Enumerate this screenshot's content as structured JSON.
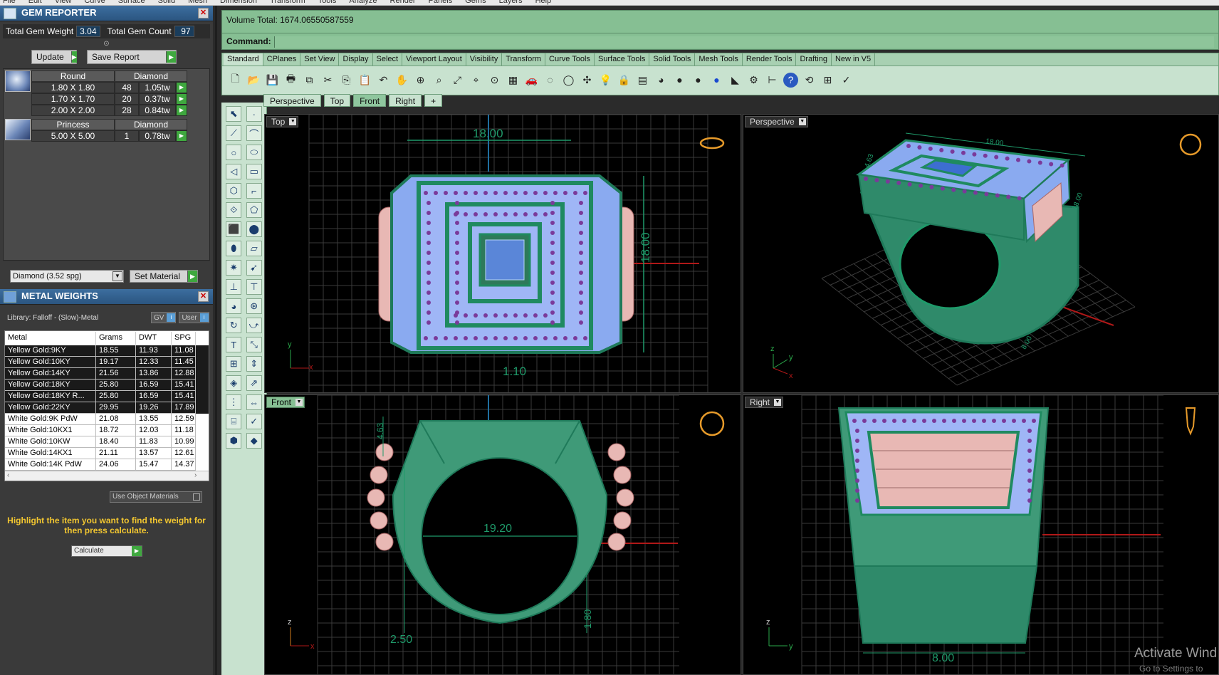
{
  "menubar": [
    "File",
    "Edit",
    "View",
    "Curve",
    "Surface",
    "Solid",
    "Mesh",
    "Dimension",
    "Transform",
    "Tools",
    "Analyze",
    "Render",
    "Panels",
    "Gems",
    "Layers",
    "Help"
  ],
  "gem_reporter": {
    "title": "GEM REPORTER",
    "total_weight_label": "Total Gem Weight",
    "total_weight": "3.04",
    "total_count_label": "Total Gem Count",
    "total_count": "97",
    "update_label": "Update",
    "save_report_label": "Save Report",
    "groups": [
      {
        "shape": "Round",
        "material": "Diamond",
        "rows": [
          {
            "size": "1.80 X 1.80",
            "count": "48",
            "tw": "1.05tw"
          },
          {
            "size": "1.70 X 1.70",
            "count": "20",
            "tw": "0.37tw"
          },
          {
            "size": "2.00 X 2.00",
            "count": "28",
            "tw": "0.84tw"
          }
        ]
      },
      {
        "shape": "Princess",
        "material": "Diamond",
        "rows": [
          {
            "size": "5.00 X 5.00",
            "count": "1",
            "tw": "0.78tw"
          }
        ]
      }
    ],
    "material_select": "Diamond     (3.52 spg)",
    "set_material_label": "Set Material"
  },
  "metal_weights": {
    "title": "METAL WEIGHTS",
    "library": "Library: Falloff - (Slow)-Metal",
    "chip_gv": "GV",
    "chip_user": "User",
    "columns": [
      "Metal",
      "Grams",
      "DWT",
      "SPG"
    ],
    "rows": [
      {
        "metal": "Yellow Gold:9KY",
        "grams": "18.55",
        "dwt": "11.93",
        "spg": "11.08"
      },
      {
        "metal": "Yellow Gold:10KY",
        "grams": "19.17",
        "dwt": "12.33",
        "spg": "11.45"
      },
      {
        "metal": "Yellow Gold:14KY",
        "grams": "21.56",
        "dwt": "13.86",
        "spg": "12.88"
      },
      {
        "metal": "Yellow Gold:18KY",
        "grams": "25.80",
        "dwt": "16.59",
        "spg": "15.41"
      },
      {
        "metal": "Yellow Gold:18KY R...",
        "grams": "25.80",
        "dwt": "16.59",
        "spg": "15.41"
      },
      {
        "metal": "Yellow Gold:22KY",
        "grams": "29.95",
        "dwt": "19.26",
        "spg": "17.89"
      },
      {
        "metal": "White Gold:9K PdW",
        "grams": "21.08",
        "dwt": "13.55",
        "spg": "12.59"
      },
      {
        "metal": "White Gold:10KX1",
        "grams": "18.72",
        "dwt": "12.03",
        "spg": "11.18"
      },
      {
        "metal": "White Gold:10KW",
        "grams": "18.40",
        "dwt": "11.83",
        "spg": "10.99"
      },
      {
        "metal": "White Gold:14KX1",
        "grams": "21.11",
        "dwt": "13.57",
        "spg": "12.61"
      },
      {
        "metal": "White Gold:14K PdW",
        "grams": "24.06",
        "dwt": "15.47",
        "spg": "14.37"
      }
    ],
    "use_object_label": "Use Object Materials",
    "hint": "Highlight the item you want to find the weight for then press calculate.",
    "calculate_label": "Calculate"
  },
  "command": {
    "history": "Volume Total: 1674.06550587559",
    "prompt": "Command:"
  },
  "toolbar_tabs": [
    "Standard",
    "CPlanes",
    "Set View",
    "Display",
    "Select",
    "Viewport Layout",
    "Visibility",
    "Transform",
    "Curve Tools",
    "Surface Tools",
    "Solid Tools",
    "Mesh Tools",
    "Render Tools",
    "Drafting",
    "New in V5"
  ],
  "toolbar_icons": [
    "new-icon",
    "open-icon",
    "save-icon",
    "print-icon",
    "import-icon",
    "cut-icon",
    "copy-icon",
    "paste-icon",
    "undo-icon",
    "pan-icon",
    "rotate-icon",
    "zoom-window-icon",
    "zoom-extents-icon",
    "zoom-selected-icon",
    "zoom-in-icon",
    "grid-four-view-icon",
    "car-icon",
    "ghost-icon",
    "circle-icon",
    "point-icon",
    "light-icon",
    "lock-icon",
    "layer-icon",
    "color-wheel-icon",
    "sphere-shaded-icon",
    "sphere-render-icon",
    "sphere-blue-icon",
    "highlight-icon",
    "gear-icon",
    "dimension-icon",
    "help-icon",
    "tools-icon",
    "grid-icon",
    "check-curve-icon"
  ],
  "viewport_tabs": [
    "Perspective",
    "Top",
    "Front",
    "Right",
    "+"
  ],
  "active_viewport_tab": "Front",
  "viewports": {
    "top": {
      "label": "Top",
      "dim_width": "18.00",
      "dim_height": "18.00",
      "dim_small": "1.10",
      "axis_y": "y",
      "axis_x": "x"
    },
    "perspective": {
      "label": "Perspective",
      "dim_a": "18.00",
      "dim_b": "4.63",
      "dim_c": "18.00",
      "dim_d": "8.00",
      "axis_z": "z",
      "axis_y": "y",
      "axis_x": "x"
    },
    "front": {
      "label": "Front",
      "dim_inner": "19.20",
      "dim_top": "4.63",
      "dim_shank": "2.50",
      "dim_side": "1.80",
      "axis_z": "z",
      "axis_x": "x"
    },
    "right": {
      "label": "Right",
      "dim_base": "8.00",
      "axis_z": "z",
      "axis_y": "y"
    }
  },
  "watermark": "Activate Wind",
  "watermark_sub": "Go to Settings to"
}
